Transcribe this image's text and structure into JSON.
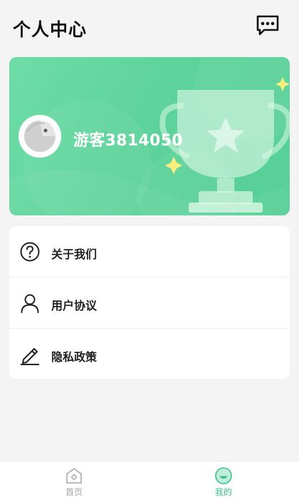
{
  "header": {
    "title": "个人中心",
    "message_icon": "message-dots-icon"
  },
  "profile": {
    "username": "游客3814050",
    "avatar_icon": "avatar-icon",
    "trophy_icon": "trophy-icon"
  },
  "menu": {
    "items": [
      {
        "label": "关于我们",
        "icon": "question-circle-icon"
      },
      {
        "label": "用户协议",
        "icon": "user-icon"
      },
      {
        "label": "隐私政策",
        "icon": "pen-icon"
      }
    ]
  },
  "tabbar": {
    "tabs": [
      {
        "label": "首页",
        "icon": "home-icon",
        "active": false
      },
      {
        "label": "我的",
        "icon": "smile-face-icon",
        "active": true
      }
    ]
  },
  "colors": {
    "accent": "#3dc28e",
    "banner": "#5ed39b",
    "inactive": "#a4a4a4"
  }
}
